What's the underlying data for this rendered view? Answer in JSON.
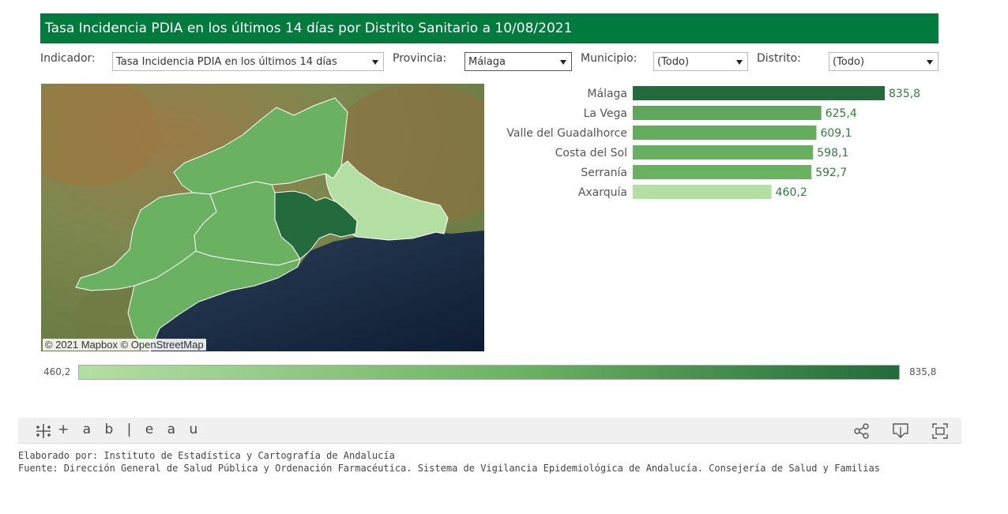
{
  "title": "Tasa Incidencia PDIA en los últimos 14 días por Distrito Sanitario a 10/08/2021",
  "filters": {
    "indicador": {
      "label": "Indicador:",
      "value": "Tasa Incidencia PDIA en los últimos 14 días"
    },
    "provincia": {
      "label": "Provincia:",
      "value": "Málaga"
    },
    "municipio": {
      "label": "Municipio:",
      "value": "(Todo)"
    },
    "distrito": {
      "label": "Distrito:",
      "value": "(Todo)"
    }
  },
  "map": {
    "attribution": "© 2021 Mapbox  © OpenStreetMap"
  },
  "colors": {
    "brand": "#007a3d",
    "scale_low": "#b3dfa3",
    "scale_mid": "#6ab162",
    "scale_high": "#236b3c",
    "value_text": "#2e7d3a"
  },
  "chart_data": {
    "type": "bar",
    "orientation": "horizontal",
    "categories": [
      "Málaga",
      "La Vega",
      "Valle del Guadalhorce",
      "Costa del Sol",
      "Serranía",
      "Axarquía"
    ],
    "values": [
      835.8,
      625.4,
      609.1,
      598.1,
      592.7,
      460.2
    ],
    "value_labels": [
      "835,8",
      "625,4",
      "609,1",
      "598,1",
      "592,7",
      "460,2"
    ]
  },
  "legend": {
    "min_label": "460,2",
    "max_label": "835,8"
  },
  "toolbar": {
    "logo_text": "+ a b | e a u"
  },
  "footer": {
    "elaborado": "Elaborado por: Instituto de Estadística y Cartografía de Andalucía",
    "fuente": "Fuente: Dirección General de Salud Pública y Ordenación Farmacéutica. Sistema de Vigilancia Epidemiológica de Andalucía. Consejería de Salud y Familias"
  }
}
